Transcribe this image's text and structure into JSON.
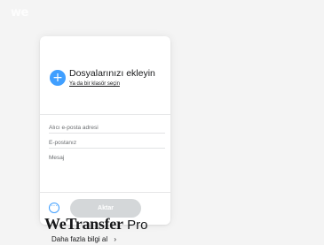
{
  "header": {
    "logo_text": "we"
  },
  "upload_panel": {
    "add_files_title": "Dosyalarınızı ekleyin",
    "add_folder_link": "Ya da bir klasör seçin",
    "recipient_placeholder": "Alıcı e-posta adresi",
    "sender_placeholder": "E-postanız",
    "message_placeholder": "Mesaj",
    "transfer_button": "Aktar"
  },
  "promo": {
    "brand": "WeTransfer",
    "suffix": "Pro",
    "link_text": "Daha fazla bilgi al",
    "link_chevron": "›"
  },
  "colors": {
    "accent": "#409fff",
    "button_disabled": "#d4d7d9",
    "background": "#f4f4f4"
  },
  "icons": {
    "add": "plus-icon",
    "options": "ellipsis-icon"
  }
}
